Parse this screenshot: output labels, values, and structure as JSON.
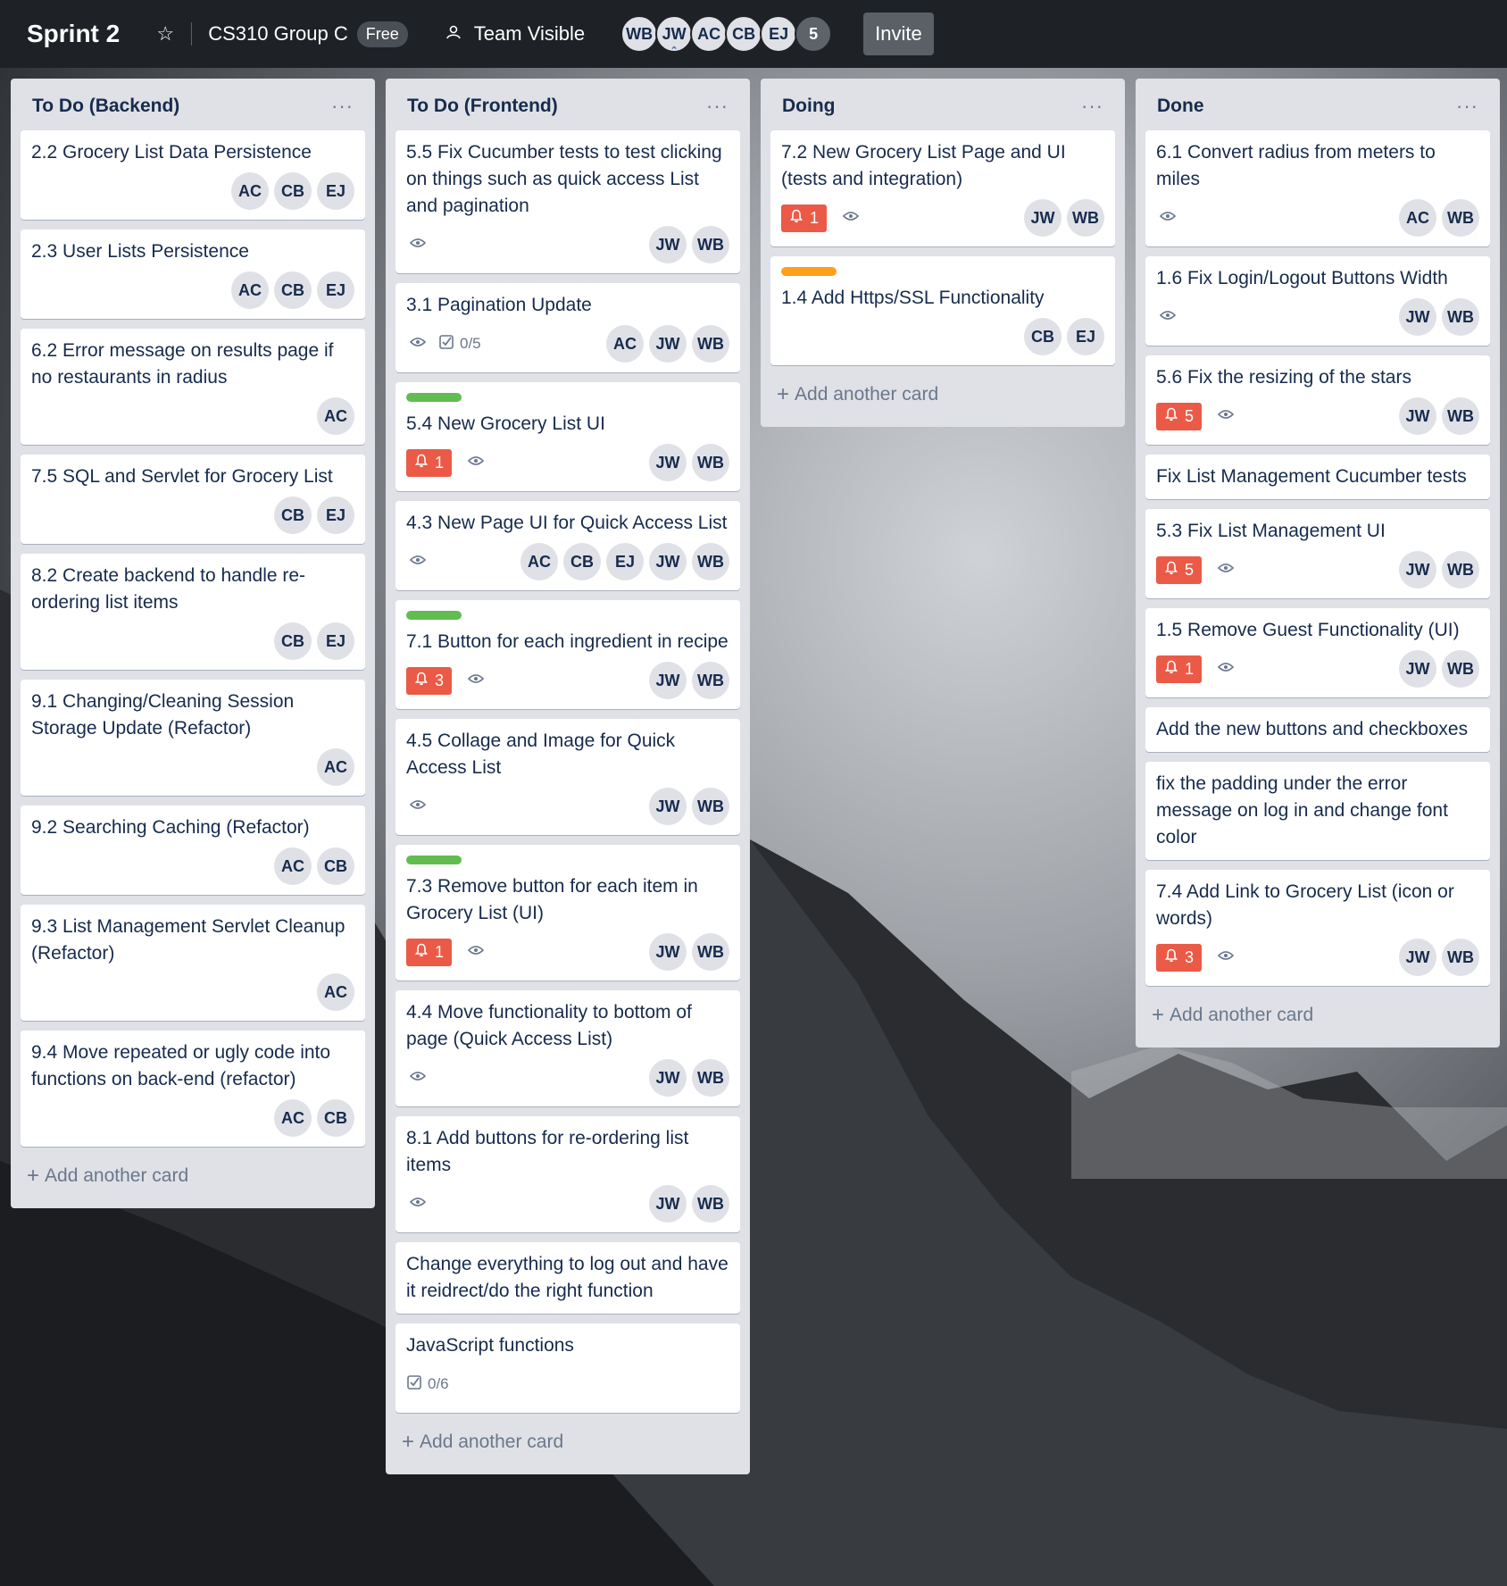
{
  "header": {
    "board_title": "Sprint 2",
    "team_name": "CS310 Group C",
    "plan_badge": "Free",
    "visibility": "Team Visible",
    "members": [
      "WB",
      "JW",
      "AC",
      "CB",
      "EJ"
    ],
    "member_overflow": "5",
    "invite_label": "Invite"
  },
  "lists": [
    {
      "title": "To Do (Backend)",
      "menu": "···",
      "add_label": "Add another card",
      "cards": [
        {
          "title": "2.2 Grocery List Data Persistence",
          "members": [
            "AC",
            "CB",
            "EJ"
          ]
        },
        {
          "title": "2.3 User Lists Persistence",
          "members": [
            "AC",
            "CB",
            "EJ"
          ]
        },
        {
          "title": "6.2 Error message on results page if no restaurants in radius",
          "members": [
            "AC"
          ]
        },
        {
          "title": "7.5 SQL and Servlet for Grocery List",
          "members": [
            "CB",
            "EJ"
          ]
        },
        {
          "title": "8.2 Create backend to handle re-ordering list items",
          "members": [
            "CB",
            "EJ"
          ]
        },
        {
          "title": "9.1 Changing/Cleaning Session Storage Update (Refactor)",
          "members": [
            "AC"
          ]
        },
        {
          "title": "9.2 Searching Caching (Refactor)",
          "members": [
            "AC",
            "CB"
          ]
        },
        {
          "title": "9.3 List Management Servlet Cleanup (Refactor)",
          "members": [
            "AC"
          ]
        },
        {
          "title": "9.4 Move repeated or ugly code into functions on back-end (refactor)",
          "members": [
            "AC",
            "CB"
          ]
        }
      ]
    },
    {
      "title": "To Do (Frontend)",
      "menu": "···",
      "add_label": "Add another card",
      "cards": [
        {
          "title": "5.5 Fix Cucumber tests to test clicking on things such as quick access List and pagination",
          "watch": true,
          "members": [
            "JW",
            "WB"
          ]
        },
        {
          "title": "3.1 Pagination Update",
          "watch": true,
          "checklist": "0/5",
          "members": [
            "AC",
            "JW",
            "WB"
          ]
        },
        {
          "label": "#61bd4f",
          "title": "5.4 New Grocery List UI",
          "alert": "1",
          "watch": true,
          "members": [
            "JW",
            "WB"
          ]
        },
        {
          "title": "4.3 New Page UI for Quick Access List",
          "watch": true,
          "members": [
            "AC",
            "CB",
            "EJ",
            "JW",
            "WB"
          ]
        },
        {
          "label": "#61bd4f",
          "title": "7.1 Button for each ingredient in recipe",
          "alert": "3",
          "watch": true,
          "members": [
            "JW",
            "WB"
          ]
        },
        {
          "title": "4.5 Collage and Image for Quick Access List",
          "watch": true,
          "members": [
            "JW",
            "WB"
          ]
        },
        {
          "label": "#61bd4f",
          "title": "7.3 Remove button for each item in Grocery List (UI)",
          "alert": "1",
          "watch": true,
          "members": [
            "JW",
            "WB"
          ]
        },
        {
          "title": "4.4 Move functionality to bottom of page (Quick Access List)",
          "watch": true,
          "members": [
            "JW",
            "WB"
          ]
        },
        {
          "title": "8.1 Add buttons for re-ordering list items",
          "watch": true,
          "members": [
            "JW",
            "WB"
          ]
        },
        {
          "title": "Change everything to log out and have it reidrect/do the right function"
        },
        {
          "title": "JavaScript functions",
          "checklist": "0/6"
        }
      ]
    },
    {
      "title": "Doing",
      "menu": "···",
      "add_label": "Add another card",
      "cards": [
        {
          "title": "7.2 New Grocery List Page and UI (tests and integration)",
          "alert": "1",
          "watch": true,
          "members": [
            "JW",
            "WB"
          ]
        },
        {
          "label": "#ff9f1a",
          "title": "1.4 Add Https/SSL Functionality",
          "members": [
            "CB",
            "EJ"
          ]
        }
      ]
    },
    {
      "title": "Done",
      "menu": "···",
      "add_label": "Add another card",
      "cards": [
        {
          "title": "6.1 Convert radius from meters to miles",
          "watch": true,
          "members": [
            "AC",
            "WB"
          ]
        },
        {
          "title": "1.6 Fix Login/Logout Buttons Width",
          "watch": true,
          "members": [
            "JW",
            "WB"
          ]
        },
        {
          "title": "5.6 Fix the resizing of the stars",
          "alert": "5",
          "watch": true,
          "members": [
            "JW",
            "WB"
          ]
        },
        {
          "title": "Fix List Management Cucumber tests"
        },
        {
          "title": "5.3 Fix List Management UI",
          "alert": "5",
          "watch": true,
          "members": [
            "JW",
            "WB"
          ]
        },
        {
          "title": "1.5 Remove Guest Functionality (UI)",
          "alert": "1",
          "watch": true,
          "members": [
            "JW",
            "WB"
          ]
        },
        {
          "title": "Add the new buttons and checkboxes"
        },
        {
          "title": "fix the padding under the error message on log in and change font color"
        },
        {
          "title": "7.4 Add Link to Grocery List (icon or words)",
          "alert": "3",
          "watch": true,
          "members": [
            "JW",
            "WB"
          ]
        }
      ]
    }
  ],
  "icons": {
    "star": "☆",
    "visibility": "team-icon",
    "watch": "eye-icon",
    "alert": "bell-icon",
    "checklist": "checkbox-icon",
    "add": "plus-icon"
  },
  "colors": {
    "header_bg": "#1e2226",
    "list_bg": "#dfe1e6",
    "alert_red": "#eb5a46",
    "label_green": "#61bd4f",
    "label_orange": "#ff9f1a"
  }
}
